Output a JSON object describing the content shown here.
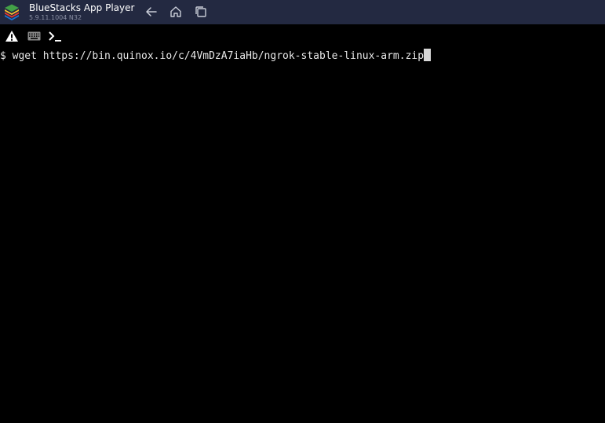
{
  "window": {
    "title": "BlueStacks App Player",
    "version": "5.9.11.1004  N32",
    "logo_icon": "bluestacks-logo-icon",
    "nav": {
      "back_icon": "arrow-left-icon",
      "home_icon": "home-icon",
      "recents_icon": "recent-apps-icon"
    }
  },
  "terminal": {
    "extra_keys": [
      "warning-icon",
      "keyboard-icon",
      "terminal-prompt-icon"
    ],
    "prompt": "$",
    "command": "wget https://bin.quinox.io/c/4VmDzA7iaHb/ngrok-stable-linux-arm.zip"
  },
  "colors": {
    "titlebar": "#232941",
    "background": "#000000",
    "text": "#e8e8e8",
    "cursor": "#d8d8d8"
  }
}
